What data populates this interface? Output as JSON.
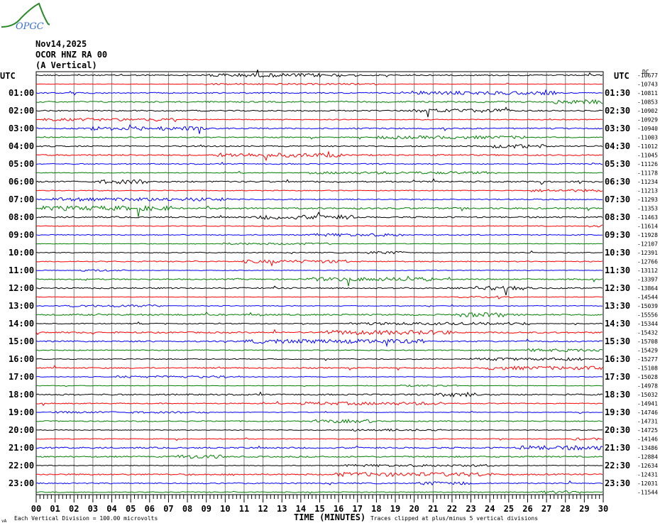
{
  "logo": {
    "text": "OPGC"
  },
  "header": {
    "date": "Nov14,2025",
    "station": "OCOR HNZ RA 00",
    "component": "(A Vertical)"
  },
  "utc_left": "UTC",
  "utc_right": "UTC",
  "dc_label": "DC",
  "footer": {
    "scale": "Each Vertical Division =  100.00 microvolts",
    "xlabel": "TIME (MINUTES)",
    "clip_note": "Traces clipped at plus/minus 5 vertical divisions",
    "corner": "vA"
  },
  "colors": {
    "trace_cycle": [
      "#000000",
      "#ff0000",
      "#0000ff",
      "#008000"
    ],
    "grid": "#808080"
  },
  "chart_data": {
    "type": "line",
    "title": "OCOR HNZ RA 00 helicorder",
    "xlabel": "TIME (MINUTES)",
    "xlim": [
      0,
      30
    ],
    "x_ticks": [
      "00",
      "01",
      "02",
      "03",
      "04",
      "05",
      "06",
      "07",
      "08",
      "09",
      "10",
      "11",
      "12",
      "13",
      "14",
      "15",
      "16",
      "17",
      "18",
      "19",
      "20",
      "21",
      "22",
      "23",
      "24",
      "25",
      "26",
      "27",
      "28",
      "29",
      "30"
    ],
    "left_labels": [
      "01:00",
      "02:00",
      "03:00",
      "04:00",
      "05:00",
      "06:00",
      "07:00",
      "08:00",
      "09:00",
      "10:00",
      "11:00",
      "12:00",
      "13:00",
      "14:00",
      "15:00",
      "16:00",
      "17:00",
      "18:00",
      "19:00",
      "20:00",
      "21:00",
      "22:00",
      "23:00"
    ],
    "right_labels": [
      "01:30",
      "02:30",
      "03:30",
      "04:30",
      "05:30",
      "06:30",
      "07:30",
      "08:30",
      "09:30",
      "10:30",
      "11:30",
      "12:30",
      "13:30",
      "14:30",
      "15:30",
      "16:30",
      "17:30",
      "18:30",
      "19:30",
      "20:30",
      "21:30",
      "22:30",
      "23:30"
    ],
    "trace_dc_offsets": [
      "-10677",
      "-10743",
      "-10811",
      "-10853",
      "-10902",
      "-10929",
      "-10940",
      "-11003",
      "-11012",
      "-11045",
      "-11126",
      "-11178",
      "-11234",
      "-11213",
      "-11293",
      "-11353",
      "-11463",
      "-11614",
      "-11928",
      "-12107",
      "-12391",
      "-12766",
      "-13112",
      "-13397",
      "-13864",
      "-14544",
      "-15039",
      "-15556",
      "-15344",
      "-15432",
      "-15708",
      "-15429",
      "-15277",
      "-15108",
      "-15028",
      "-14978",
      "-15032",
      "-14941",
      "-14746",
      "-14731",
      "-14725",
      "-14146",
      "-13486",
      "-12884",
      "-12634",
      "-12431",
      "-12031",
      "-11544"
    ]
  }
}
